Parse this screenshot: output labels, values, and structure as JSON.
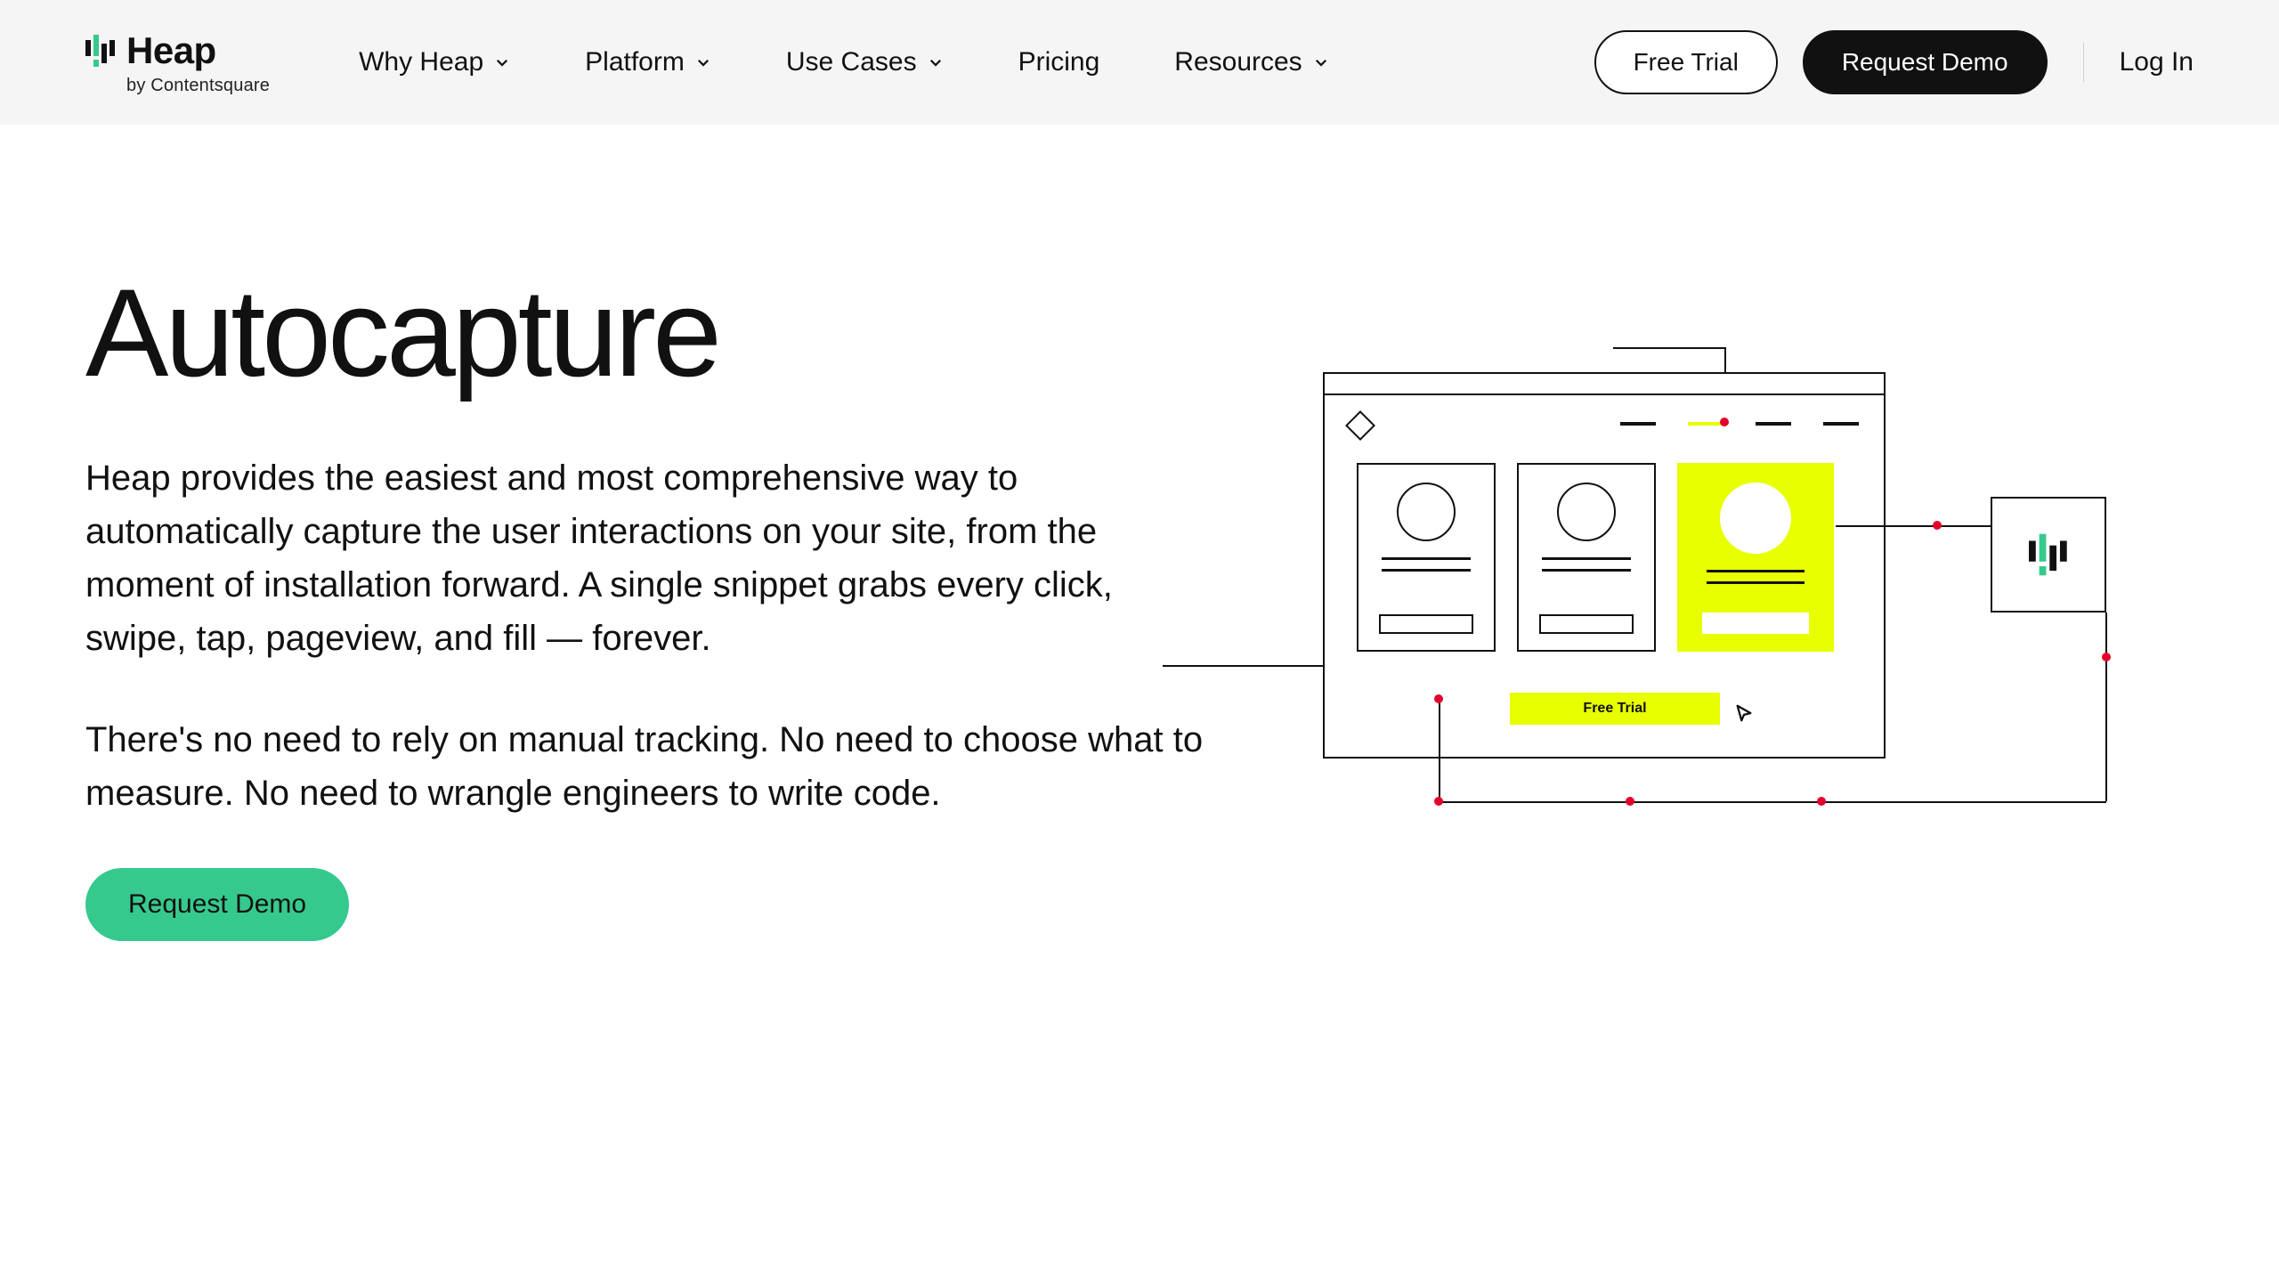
{
  "brand": {
    "name": "Heap",
    "tagline": "by Contentsquare"
  },
  "nav": {
    "items": [
      {
        "label": "Why Heap",
        "dropdown": true
      },
      {
        "label": "Platform",
        "dropdown": true
      },
      {
        "label": "Use Cases",
        "dropdown": true
      },
      {
        "label": "Pricing",
        "dropdown": false
      },
      {
        "label": "Resources",
        "dropdown": true
      }
    ],
    "free_trial": "Free Trial",
    "request_demo": "Request Demo",
    "login": "Log In"
  },
  "hero": {
    "title": "Autocapture",
    "p1": "Heap provides the easiest and most comprehensive way to automatically capture the user interactions on your site, from the moment of installation forward. A single snippet grabs every click, swipe, tap, pageview, and fill — forever.",
    "p2": "There's no need to rely on manual tracking. No need to choose what to measure. No need to wrangle engineers to write code.",
    "cta": "Request Demo"
  },
  "illustration": {
    "free_trial_label": "Free Trial"
  },
  "colors": {
    "accent_green": "#36c98e",
    "accent_yellow": "#e8ff00",
    "node_red": "#e3002b"
  }
}
